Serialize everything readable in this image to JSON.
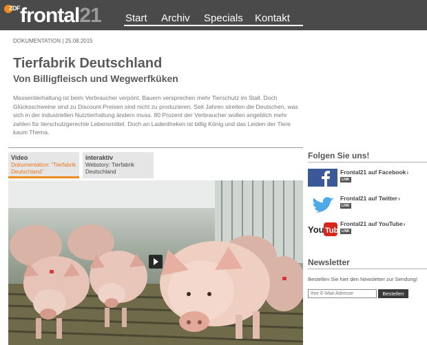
{
  "header": {
    "logo_word": "frontal",
    "logo_num": "21",
    "logo_zdf": "ZDF",
    "nav": [
      "Start",
      "Archiv",
      "Specials",
      "Kontakt"
    ]
  },
  "article": {
    "category": "Dokumentation",
    "date": "| 25.08.2015",
    "title": "Tierfabrik Deutschland",
    "subtitle": "Von Billigfleisch und Wegwerfküken",
    "teaser": "Massentierhaltung ist beim Verbraucher verpönt. Bauern versprechen mehr Tierschutz im Stall. Doch Glücksschweine sind zu Discount-Preisen sind nicht zu produzieren. Seit Jahren streiten die Deutschen, was sich in der industriellen Nutztierhaltung ändern muss. 80 Prozent der Verbraucher wollen angeblich mehr zahlen für tierschutzgerechte Lebensmittel. Doch an Ladentheken ist billig König und das Leiden der Tiere kaum Thema."
  },
  "tabs": [
    {
      "head": "Video",
      "desc": "Dokumentation: \"Tierfabrik Deutschland\""
    },
    {
      "head": "interaktiv",
      "desc": "Webstory: Tierfabrik Deutschland"
    }
  ],
  "sidebar": {
    "follow_heading": "Folgen Sie uns!",
    "social": [
      {
        "label": "Frontal21 auf Facebook",
        "badge": "LINK",
        "icon": "facebook-icon"
      },
      {
        "label": "Frontal21 auf Twitter",
        "badge": "LINK",
        "icon": "twitter-icon"
      },
      {
        "label": "Frontal21 auf YouTube",
        "badge": "LINK",
        "icon": "youtube-icon"
      }
    ],
    "newsletter_heading": "Newsletter",
    "newsletter_text": "Bestellen Sie hier den Newsletter zur Sendung!",
    "email_placeholder": "Ihre E-Mail-Adresse",
    "submit_label": "Bestellen"
  },
  "colors": {
    "accent": "#f08a1c",
    "header_bg": "#4a4a4a"
  }
}
